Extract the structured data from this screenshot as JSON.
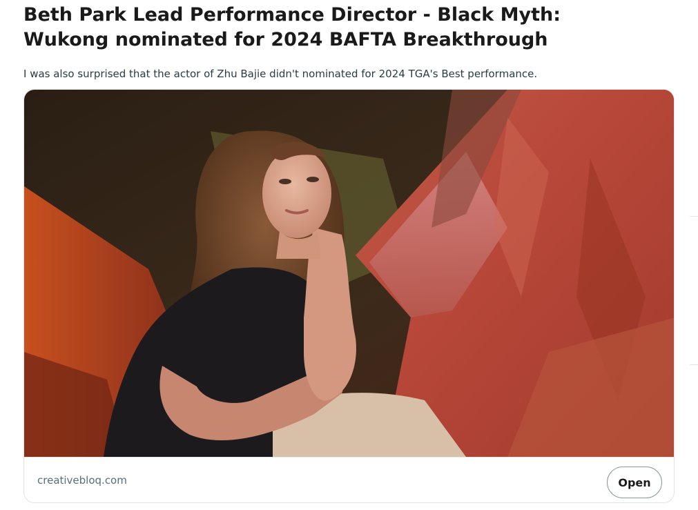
{
  "post": {
    "title": "Beth Park Lead Performance Director - Black Myth: Wukong nominated for 2024 BAFTA Breakthrough",
    "body": "I was also surprised that the actor of Zhu Bajie didn't nominated for 2024 TGA's Best performance."
  },
  "link_card": {
    "thumbnail_alt": "Portrait photo of a woman with long brown hair resting her chin on her hand in front of red and pink draped fabric",
    "domain": "creativebloq.com",
    "open_label": "Open"
  }
}
